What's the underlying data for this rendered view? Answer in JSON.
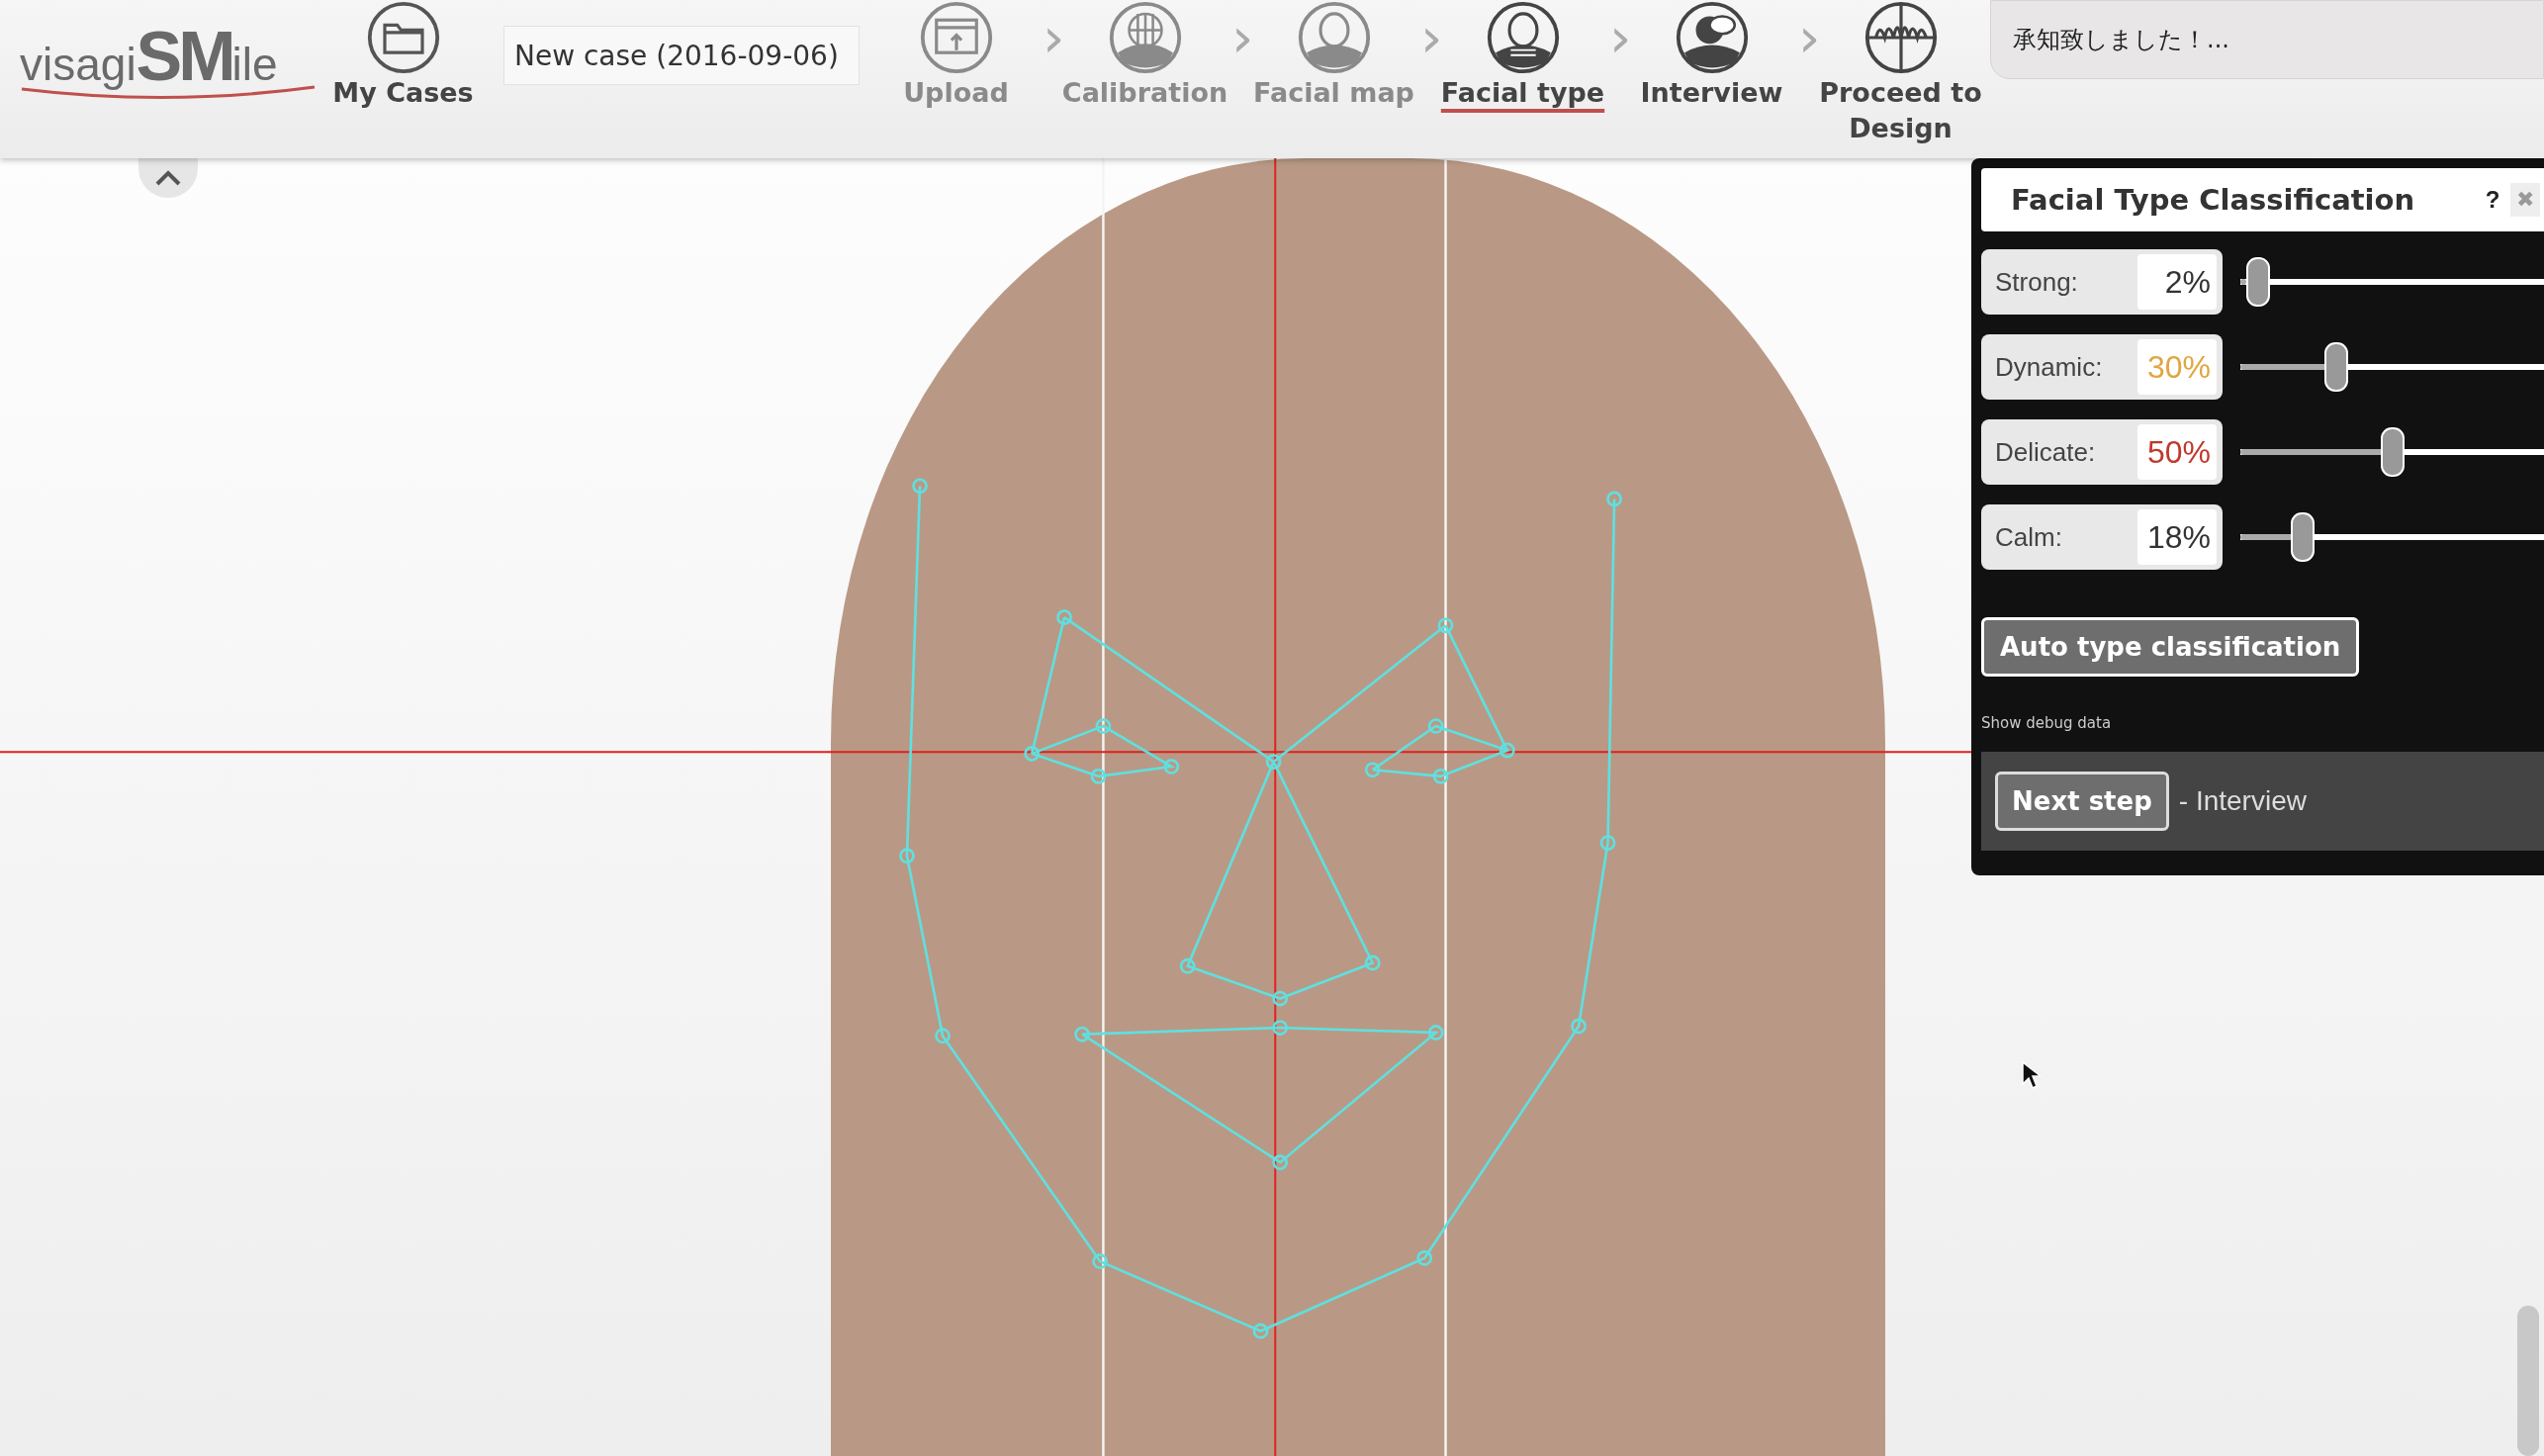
{
  "logo": {
    "prefix": "visagi",
    "mark": "SM",
    "suffix": "ile"
  },
  "my_cases": {
    "label": "My Cases"
  },
  "case_name": {
    "value": "New case (2016-09-06)"
  },
  "steps": [
    {
      "kind": "upload",
      "label": "Upload",
      "dimmed": true,
      "selected": false
    },
    {
      "kind": "calibration",
      "label": "Calibration",
      "dimmed": true,
      "selected": false
    },
    {
      "kind": "facial-map",
      "label": "Facial map",
      "dimmed": true,
      "selected": false
    },
    {
      "kind": "facial-type",
      "label": "Facial type",
      "dimmed": false,
      "selected": true
    },
    {
      "kind": "interview",
      "label": "Interview",
      "dimmed": false,
      "selected": false
    },
    {
      "kind": "design",
      "label": "Proceed to Design",
      "dimmed": false,
      "selected": false
    }
  ],
  "step_separator": "›",
  "notification": {
    "text": "承知致しました！..."
  },
  "panel": {
    "title": "Facial Type Classification",
    "help": "?",
    "close": "✖",
    "sliders": [
      {
        "label": "Strong:",
        "value": "2%",
        "level": 0.02,
        "color": "#333333"
      },
      {
        "label": "Dynamic:",
        "value": "30%",
        "level": 0.3,
        "color": "#e0a640"
      },
      {
        "label": "Delicate:",
        "value": "50%",
        "level": 0.5,
        "color": "#c0392b"
      },
      {
        "label": "Calm:",
        "value": "18%",
        "level": 0.18,
        "color": "#333333"
      }
    ],
    "auto_button": "Auto type classification",
    "debug_link": "Show debug data",
    "next_button": "Next step",
    "next_caption": "- Interview"
  }
}
